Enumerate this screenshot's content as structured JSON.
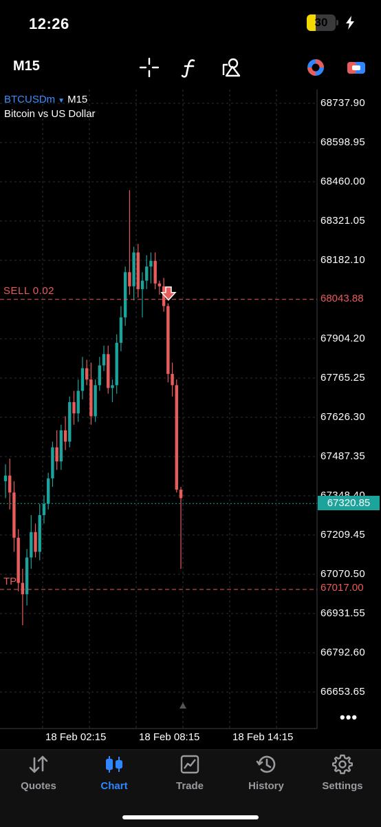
{
  "status_bar": {
    "time": "12:26",
    "battery_level": "30"
  },
  "toolbar": {
    "timeframe": "M15",
    "icons": [
      "crosshair-icon",
      "indicators-icon",
      "objects-icon",
      "one-click-trading-icon",
      "account-switch-icon"
    ]
  },
  "chart": {
    "symbol": "BTCUSDm",
    "timeframe": "M15",
    "description": "Bitcoin vs US Dollar",
    "price_labels": [
      "68737.90",
      "68598.95",
      "68460.00",
      "68321.05",
      "68182.10",
      "67904.20",
      "67765.25",
      "67626.30",
      "67487.35",
      "67348.40",
      "67209.45",
      "67070.50",
      "66931.55",
      "66792.60",
      "66653.65"
    ],
    "time_labels": [
      "18 Feb 02:15",
      "18 Feb 08:15",
      "18 Feb 14:15"
    ],
    "sell_order": {
      "label": "SELL 0.02",
      "price": "68043.88"
    },
    "take_profit": {
      "label": "TP",
      "price": "67017.00"
    },
    "current_price": "67320.85",
    "colors": {
      "bull": "#1ba39c",
      "bear": "#e85c5c",
      "grid": "#2a2f3a",
      "bid": "#1ba39c",
      "accent": "#2f86ff"
    }
  },
  "chart_data": {
    "type": "candlestick",
    "symbol": "BTCUSDm",
    "interval": "M15",
    "ylim": [
      66600,
      68800
    ],
    "ohlc": [
      [
        67400,
        67460,
        67340,
        67420
      ],
      [
        67420,
        67480,
        67300,
        67360
      ],
      [
        67360,
        67400,
        67150,
        67200
      ],
      [
        67200,
        67230,
        67010,
        67040
      ],
      [
        67040,
        67090,
        66890,
        67000
      ],
      [
        67000,
        67160,
        66960,
        67130
      ],
      [
        67130,
        67280,
        67090,
        67220
      ],
      [
        67220,
        67250,
        67130,
        67150
      ],
      [
        67150,
        67320,
        67120,
        67280
      ],
      [
        67280,
        67350,
        67250,
        67320
      ],
      [
        67320,
        67430,
        67300,
        67410
      ],
      [
        67410,
        67540,
        67380,
        67520
      ],
      [
        67520,
        67580,
        67440,
        67470
      ],
      [
        67470,
        67600,
        67440,
        67580
      ],
      [
        67580,
        67630,
        67510,
        67540
      ],
      [
        67540,
        67700,
        67520,
        67680
      ],
      [
        67680,
        67720,
        67600,
        67640
      ],
      [
        67640,
        67760,
        67610,
        67720
      ],
      [
        67720,
        67840,
        67690,
        67800
      ],
      [
        67800,
        67830,
        67740,
        67760
      ],
      [
        67760,
        67820,
        67600,
        67630
      ],
      [
        67630,
        67760,
        67610,
        67740
      ],
      [
        67740,
        67840,
        67720,
        67810
      ],
      [
        67810,
        67880,
        67790,
        67850
      ],
      [
        67850,
        67880,
        67710,
        67730
      ],
      [
        67730,
        67760,
        67680,
        67740
      ],
      [
        67740,
        67920,
        67710,
        67890
      ],
      [
        67890,
        68020,
        67860,
        67980
      ],
      [
        67980,
        68160,
        67950,
        68140
      ],
      [
        68140,
        68430,
        68060,
        68090
      ],
      [
        68090,
        68230,
        68040,
        68210
      ],
      [
        68210,
        68240,
        68050,
        68080
      ],
      [
        68080,
        68140,
        67980,
        68110
      ],
      [
        68110,
        68200,
        68080,
        68160
      ],
      [
        68160,
        68210,
        68100,
        68180
      ],
      [
        68180,
        68210,
        68080,
        68100
      ],
      [
        68100,
        68110,
        68060,
        68090
      ],
      [
        68090,
        68120,
        68000,
        68020
      ],
      [
        68020,
        68030,
        67750,
        67780
      ],
      [
        67780,
        67820,
        67700,
        67740
      ],
      [
        67740,
        67760,
        67360,
        67370
      ],
      [
        67370,
        67380,
        67090,
        67340
      ]
    ]
  },
  "tabs": [
    {
      "label": "Quotes",
      "icon": "quotes-icon"
    },
    {
      "label": "Chart",
      "icon": "chart-icon",
      "active": true
    },
    {
      "label": "Trade",
      "icon": "trade-icon"
    },
    {
      "label": "History",
      "icon": "history-icon"
    },
    {
      "label": "Settings",
      "icon": "settings-icon"
    }
  ]
}
